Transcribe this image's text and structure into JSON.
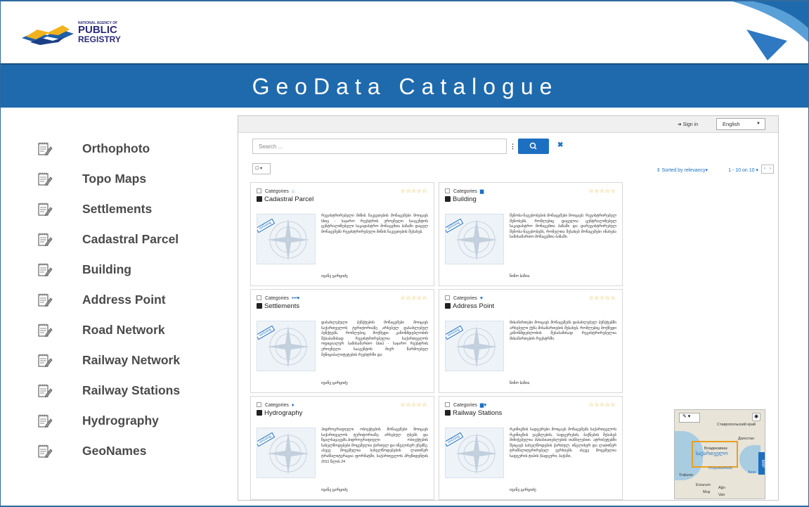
{
  "logo": {
    "org_line": "NATIONAL AGENCY OF",
    "word1": "PUBLIC",
    "word2": "REGISTRY"
  },
  "title": "GeoData Catalogue",
  "side_list": [
    "Orthophoto",
    "Topo Maps",
    "Settlements",
    "Cadastral Parcel",
    "Building",
    "Address Point",
    "Road Network",
    "Railway Network",
    "Railway Stations",
    "Hydrography",
    "GeoNames"
  ],
  "app": {
    "sign_in": "Sign in",
    "language": "English",
    "search_placeholder": "Search ...",
    "sort_label": "Sorted by relevancy",
    "pager_label": "1 - 10 on 10",
    "category_label": "Categories",
    "ribbon": "onGoing",
    "stars": "☆☆☆☆☆",
    "cards": [
      {
        "title": "Cadastral Parcel",
        "cat_icon": "⌂",
        "desc": "რეგისტრირებული მიწის ნაკვეთების მონაცემები მოიცავს სხივ - საჯარო რეესტრის ეროვნული სააგენტოს ცენტრალიზებული საკადასტრო მონაცემთა ბაზაში დაცულ მონაცემებს რეგისტრირებული მიწის ნაკვეთების შესახებ.",
        "owner": "ივანე ცარციძე"
      },
      {
        "title": "Building",
        "cat_icon": "▆",
        "desc": "შენობა-ნაგებობების მონაცემები მოიცავს: რეგისტრირებულ შენობებს, რომლებიც დაცულია ცენტრალიზებულ საკადასტრო მონაცემთა ბაზაში და დარეგისტრირებულ შენობა-ნაგებობებს, რომელთა შესახებ მონაცემები ინახება სამისამართო მონაცემთა ბაზაში.",
        "owner": "ნინო ბაზია"
      },
      {
        "title": "Settlements",
        "cat_icon": "•••♥",
        "desc": "დასახლებული პუნქტების მონაცემები მოიცავს საქართველოს ტერიტორიაზე არსებულ დასახლებულ პუნქტებს, რომლებიც მოქმედი კანონმდებლობის შესაბამისად რეგისტრირებულია საქართველოს ოფიციალურ სამისამართო სსიპ - საჯარო რეესტრის ეროვნული სააგენტოს მიერ წარმოებულ მუნიციპალიტეტების რეესტრში და",
        "owner": "ივანე ცარციძე"
      },
      {
        "title": "Address Point",
        "cat_icon": "♥",
        "desc": "მისამართები მოიცავს მონაცემებს დასახლებულ პუნქტებში არსებული ქუჩა მისამართების შესახებ, რომლებიც მოქმედი კანონმდებლობის შესაბამისად რეგისტრირებულია მისამართების რეესტრში.",
        "owner": "ნინო ბაზია"
      },
      {
        "title": "Hydrography",
        "cat_icon": "♦",
        "desc": "ჰიდროგრაფიული ობიექტების მონაცემები მოიცავს საქართველოს ტერიტორიაზე არსებულ ტბებს და წყალსაცავებს.ჰიდროგრაფიული ობიექტების სახელწოდებები მოცემულია ქართულ და ინგლისურ ენებზე. ასევე მოცემულია სახელწოდებების ლათინურ ტრანსლიტერაცია ფორმატში, საქართველოს პრეზიდენტის 2011 წლის 24",
        "owner": "ივანე ცარციძე"
      },
      {
        "title": "Railway Stations",
        "cat_icon": "▆♥",
        "desc": "რკინიგზის სადგურები მოიცავს მონაცემებს საქართველოს რკინიგზის ვაგზლების, სადგურების, ბაქნების შესახებ მინიჭებულია მახასიათებლების თანხლებით. ატრიბუტებში შეიცავს სახელწოდების ქართულ, ინგლისურ და ლათინურ ტრანსლიტერირებულ ვერსიებს. ასევე მოცემულია სადგურის ტიპის (სადგური, ბაქანი,",
        "owner": "ივანე ცარციძე"
      }
    ]
  },
  "map": {
    "places": [
      "Ставропольский край",
      "Владикавказ",
      "Дагестан",
      "Trabzon",
      "Erzurum",
      "Muş",
      "Ağrı",
      "Van",
      "Azər"
    ],
    "country": "საქართველო",
    "armenia": "Հայաստան",
    "tab": "MAP"
  }
}
